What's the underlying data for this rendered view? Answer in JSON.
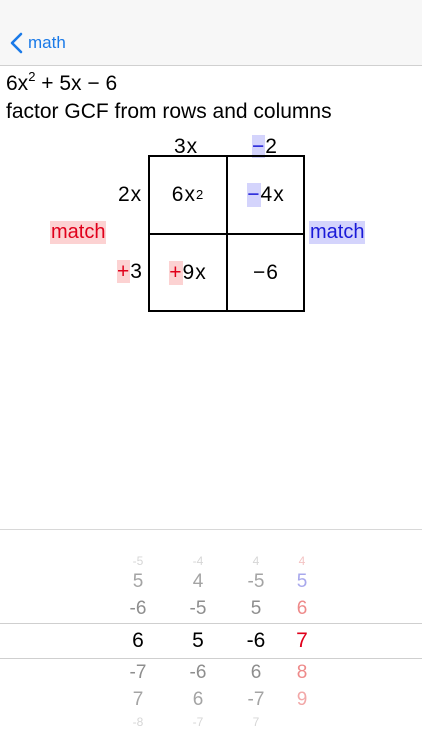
{
  "nav": {
    "back_label": "math"
  },
  "problem": {
    "expression_parts": [
      "6x",
      "2",
      " + 5x − 6"
    ],
    "instruction": "factor GCF from rows and columns"
  },
  "factors": {
    "col1": "3x",
    "col2_sign": "−",
    "col2_rest": "2",
    "row1": "2x",
    "row2_sign": "+",
    "row2_rest": "3"
  },
  "cells": {
    "top_left_base": "6x",
    "top_left_exp": "2",
    "top_right_sign": "−",
    "top_right_rest": "4x",
    "bottom_left_sign": "+",
    "bottom_left_rest": "9x",
    "bottom_right": "−6"
  },
  "match_labels": {
    "left": "match",
    "right": "match"
  },
  "colors": {
    "accent": "#1a7ae8",
    "red": "#e0001b",
    "blue": "#1a1ad8"
  },
  "picker": {
    "columns": [
      {
        "above": [
          "-5",
          "5",
          "-6"
        ],
        "selected": "6",
        "below": [
          "-7",
          "7",
          "-8"
        ]
      },
      {
        "above": [
          "-4",
          "4",
          "-5"
        ],
        "selected": "5",
        "below": [
          "-6",
          "6",
          "-7"
        ]
      },
      {
        "above": [
          "4",
          "-5",
          "5"
        ],
        "selected": "-6",
        "below": [
          "6",
          "-7",
          "7"
        ]
      },
      {
        "above": [
          "4",
          "5",
          "6"
        ],
        "selected": "7",
        "below": [
          "8",
          "9"
        ]
      }
    ]
  }
}
